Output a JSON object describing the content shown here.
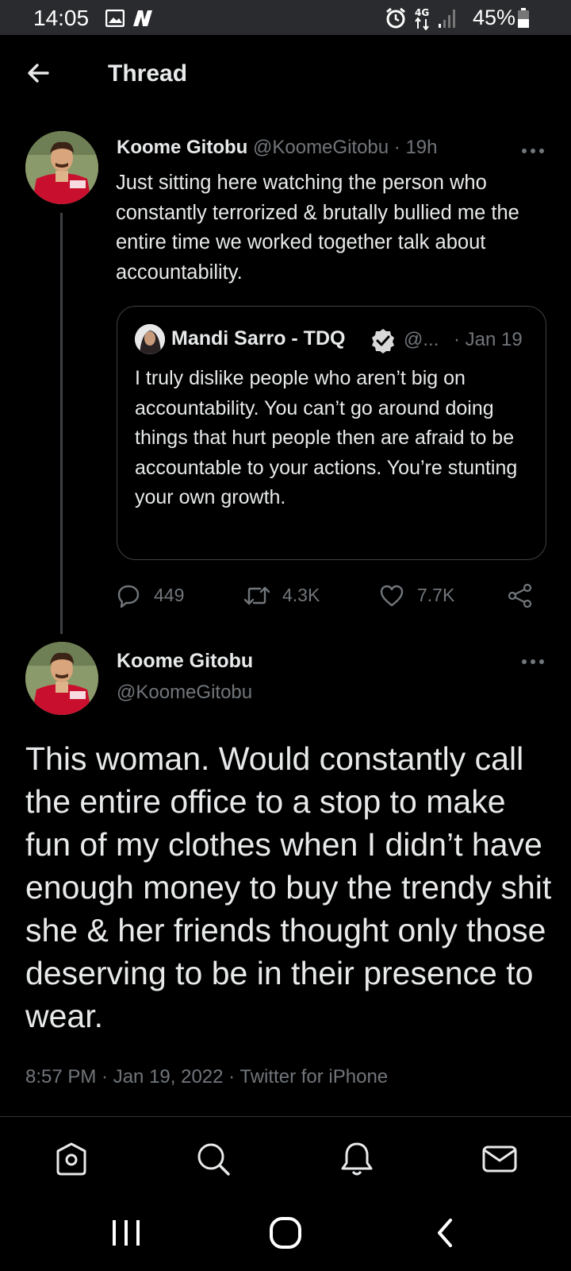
{
  "status_bar": {
    "time": "14:05",
    "network": "4G",
    "battery": "45%",
    "icons": [
      "gallery-icon",
      "n-app-icon",
      "alarm-icon",
      "network-4g-icon",
      "signal-icon",
      "battery-icon"
    ]
  },
  "header": {
    "title": "Thread",
    "back_icon": "arrow-left-icon"
  },
  "parent_tweet": {
    "name": "Koome Gitobu",
    "handle": "@KoomeGitobu",
    "separator": " · ",
    "time": "19h",
    "text": "Just sitting here watching the person who constantly terrorized & brutally bullied me the entire time we worked together talk about accountability.",
    "quote": {
      "name": "Mandi Sarro - TDQ",
      "handle": "@...",
      "date": "· Jan 19",
      "text": "I truly dislike people who aren’t big on accountability. You can’t go around doing things that hurt people then are afraid to be accountable to your actions. You’re stunting your own growth."
    },
    "actions": {
      "replies": "449",
      "retweets": "4.3K",
      "likes": "7.7K"
    }
  },
  "main_tweet": {
    "name": "Koome Gitobu",
    "handle": "@KoomeGitobu",
    "text": "This woman. Would constantly call the entire office to a stop to make fun of my clothes when I didn’t have enough money to buy the trendy shit she & her friends thought only those deserving to be in their presence to wear.",
    "timestamp": "8:57 PM · Jan 19, 2022 · Twitter for iPhone"
  },
  "bottom_nav": [
    "home-icon",
    "search-icon",
    "notifications-icon",
    "messages-icon"
  ],
  "system_nav": [
    "recents-icon",
    "home-circle-icon",
    "back-chevron-icon"
  ],
  "colors": {
    "background": "#000000",
    "text": "#e7e9ea",
    "muted": "#71767b",
    "border": "#3e4144",
    "verified_badge": "#d9d9d9"
  }
}
